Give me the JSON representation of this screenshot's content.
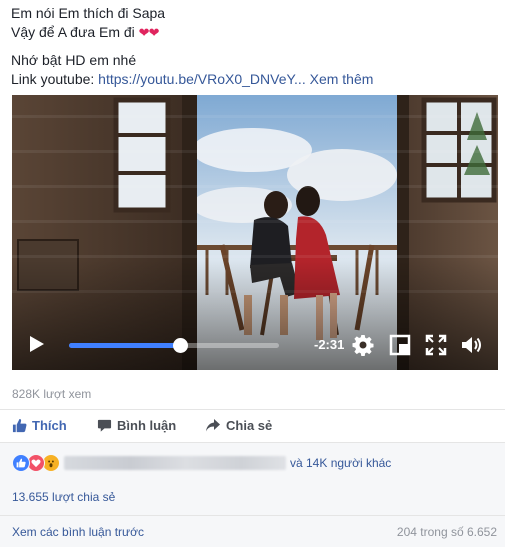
{
  "post": {
    "line1": "Em nói Em thích đi Sapa",
    "line2_text": "Vậy để A đưa Em đi ",
    "line2_emoji": "❤❤",
    "line3": "Nhớ bật HD em nhé",
    "link_label": "Link youtube: ",
    "link_url": "https://youtu.be/VRoX0_DNVeY...",
    "see_more": "Xem thêm"
  },
  "video": {
    "time_remaining": "-2:31",
    "progress_fraction": 0.53,
    "icons": [
      "play-icon",
      "settings-icon",
      "picture-in-picture-icon",
      "fullscreen-icon",
      "volume-icon"
    ]
  },
  "stats": {
    "views": "828K lượt xem"
  },
  "actions": {
    "like": "Thích",
    "comment": "Bình luận",
    "share": "Chia sẻ"
  },
  "reactions": {
    "others": "và 14K người khác",
    "types": [
      "like",
      "love",
      "wow"
    ],
    "colors": {
      "like": "#4080ff",
      "love": "#f25268",
      "wow": "#f7b125"
    }
  },
  "shares": "13.655 lượt chia sẻ",
  "comments": {
    "view_previous": "Xem các bình luận trước",
    "count": "204 trong số 6.652"
  }
}
